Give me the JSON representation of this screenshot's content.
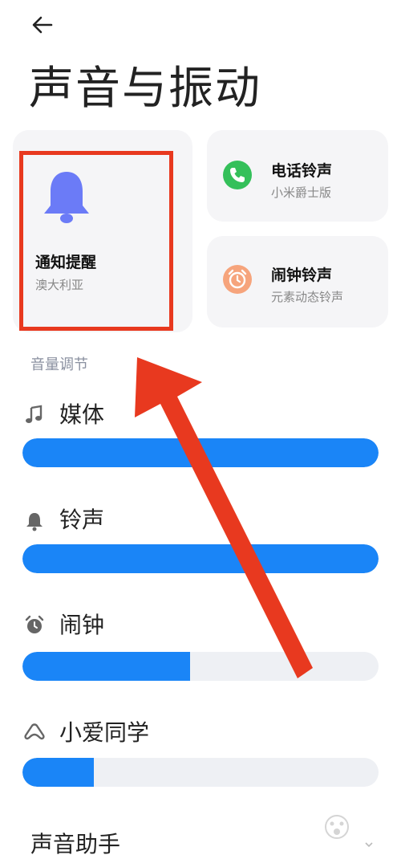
{
  "header": {
    "title": "声音与振动"
  },
  "cards": {
    "notify": {
      "title": "通知提醒",
      "subtitle": "澳大利亚"
    },
    "ringtone": {
      "title": "电话铃声",
      "subtitle": "小米爵士版"
    },
    "alarm": {
      "title": "闹钟铃声",
      "subtitle": "元素动态铃声"
    }
  },
  "volume": {
    "section_label": "音量调节",
    "items": [
      {
        "label": "媒体",
        "icon": "music-note-icon",
        "level": 1.0
      },
      {
        "label": "铃声",
        "icon": "bell-icon",
        "level": 1.0
      },
      {
        "label": "闹钟",
        "icon": "alarm-clock-icon",
        "level": 0.47
      },
      {
        "label": "小爱同学",
        "icon": "xiaoai-icon",
        "level": 0.2
      }
    ]
  },
  "footer_section": {
    "title": "声音助手"
  },
  "colors": {
    "accent": "#1a85f7",
    "highlight": "#e8391f",
    "bell": "#6b7bf7",
    "phone": "#34c05a",
    "alarm": "#f6a47c"
  }
}
